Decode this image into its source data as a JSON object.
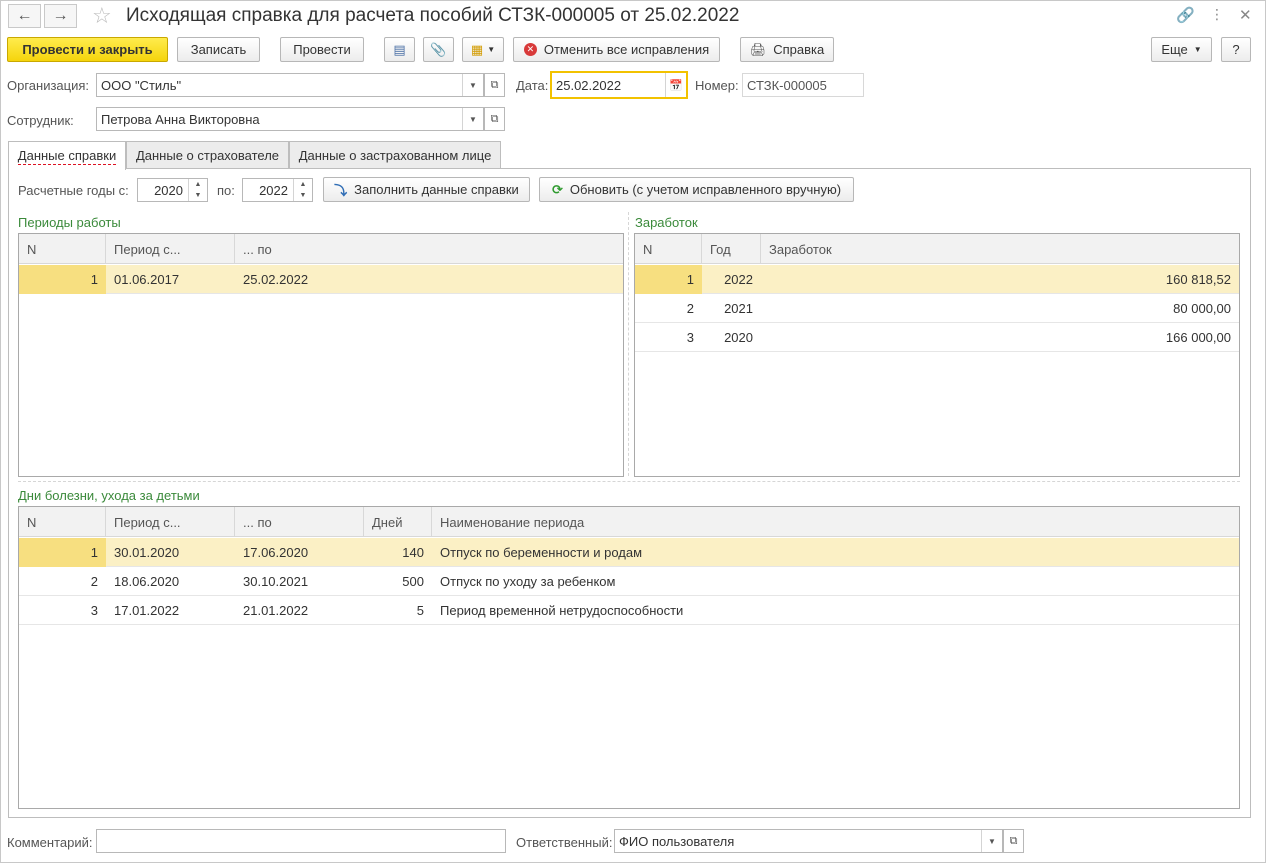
{
  "window": {
    "title": "Исходящая справка для расчета пособий СТЗК-000005 от 25.02.2022"
  },
  "toolbar": {
    "post_close": "Провести и закрыть",
    "save": "Записать",
    "post": "Провести",
    "cancel_fixes": "Отменить все исправления",
    "help": "Справка",
    "more": "Еще",
    "question": "?"
  },
  "header": {
    "org_label": "Организация:",
    "org_value": "ООО \"Стиль\"",
    "date_label": "Дата:",
    "date_value": "25.02.2022",
    "number_label": "Номер:",
    "number_value": "СТЗК-000005",
    "employee_label": "Сотрудник:",
    "employee_value": "Петрова Анна Викторовна"
  },
  "tabs": [
    {
      "label": "Данные справки"
    },
    {
      "label": "Данные о страхователе"
    },
    {
      "label": "Данные о застрахованном лице"
    }
  ],
  "years": {
    "from_label": "Расчетные годы с:",
    "from_value": "2020",
    "to_label": "по:",
    "to_value": "2022",
    "fill_button": "Заполнить данные справки",
    "refresh_button": "Обновить (с учетом исправленного вручную)"
  },
  "work_periods": {
    "title": "Периоды работы",
    "columns": [
      "N",
      "Период с...",
      "... по"
    ],
    "rows": [
      {
        "n": "1",
        "from": "01.06.2017",
        "to": "25.02.2022"
      }
    ]
  },
  "earnings": {
    "title": "Заработок",
    "columns": [
      "N",
      "Год",
      "Заработок"
    ],
    "rows": [
      {
        "n": "1",
        "year": "2022",
        "amount": "160 818,52"
      },
      {
        "n": "2",
        "year": "2021",
        "amount": "80 000,00"
      },
      {
        "n": "3",
        "year": "2020",
        "amount": "166 000,00"
      }
    ]
  },
  "sick_days": {
    "title": "Дни болезни, ухода за детьми",
    "columns": [
      "N",
      "Период с...",
      "... по",
      "Дней",
      "Наименование периода"
    ],
    "rows": [
      {
        "n": "1",
        "from": "30.01.2020",
        "to": "17.06.2020",
        "days": "140",
        "name": "Отпуск по беременности и родам"
      },
      {
        "n": "2",
        "from": "18.06.2020",
        "to": "30.10.2021",
        "days": "500",
        "name": "Отпуск по уходу за ребенком"
      },
      {
        "n": "3",
        "from": "17.01.2022",
        "to": "21.01.2022",
        "days": "5",
        "name": "Период временной нетрудоспособности"
      }
    ]
  },
  "footer": {
    "comment_label": "Комментарий:",
    "comment_value": "",
    "responsible_label": "Ответственный:",
    "responsible_value": "ФИО пользователя"
  }
}
